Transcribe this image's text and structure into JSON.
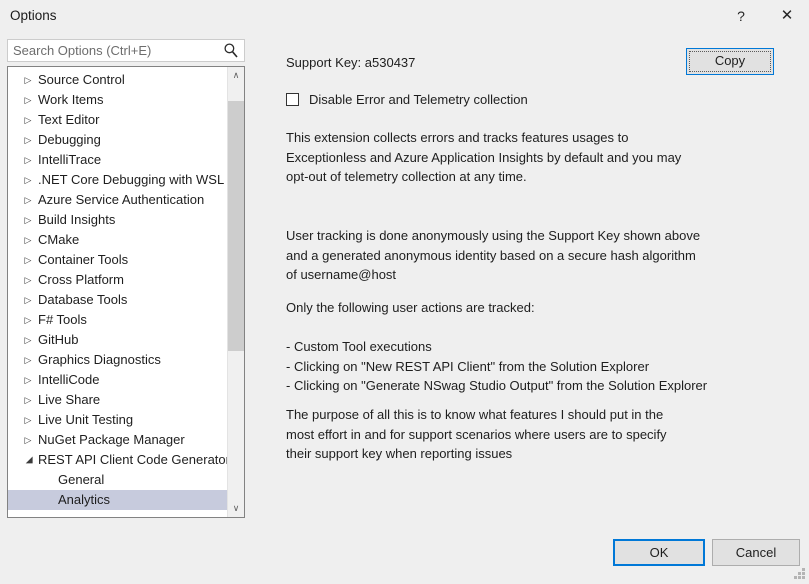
{
  "window": {
    "title": "Options",
    "help_glyph": "?",
    "close_glyph": "✕"
  },
  "search": {
    "placeholder": "Search Options (Ctrl+E)",
    "value": "",
    "icon": "search-icon"
  },
  "tree": {
    "items": [
      {
        "label": "Source Control",
        "expandable": true,
        "expanded": false,
        "selected": false,
        "child": false
      },
      {
        "label": "Work Items",
        "expandable": true,
        "expanded": false,
        "selected": false,
        "child": false
      },
      {
        "label": "Text Editor",
        "expandable": true,
        "expanded": false,
        "selected": false,
        "child": false
      },
      {
        "label": "Debugging",
        "expandable": true,
        "expanded": false,
        "selected": false,
        "child": false
      },
      {
        "label": "IntelliTrace",
        "expandable": true,
        "expanded": false,
        "selected": false,
        "child": false
      },
      {
        "label": ".NET Core Debugging with WSL",
        "expandable": true,
        "expanded": false,
        "selected": false,
        "child": false
      },
      {
        "label": "Azure Service Authentication",
        "expandable": true,
        "expanded": false,
        "selected": false,
        "child": false
      },
      {
        "label": "Build Insights",
        "expandable": true,
        "expanded": false,
        "selected": false,
        "child": false
      },
      {
        "label": "CMake",
        "expandable": true,
        "expanded": false,
        "selected": false,
        "child": false
      },
      {
        "label": "Container Tools",
        "expandable": true,
        "expanded": false,
        "selected": false,
        "child": false
      },
      {
        "label": "Cross Platform",
        "expandable": true,
        "expanded": false,
        "selected": false,
        "child": false
      },
      {
        "label": "Database Tools",
        "expandable": true,
        "expanded": false,
        "selected": false,
        "child": false
      },
      {
        "label": "F# Tools",
        "expandable": true,
        "expanded": false,
        "selected": false,
        "child": false
      },
      {
        "label": "GitHub",
        "expandable": true,
        "expanded": false,
        "selected": false,
        "child": false
      },
      {
        "label": "Graphics Diagnostics",
        "expandable": true,
        "expanded": false,
        "selected": false,
        "child": false
      },
      {
        "label": "IntelliCode",
        "expandable": true,
        "expanded": false,
        "selected": false,
        "child": false
      },
      {
        "label": "Live Share",
        "expandable": true,
        "expanded": false,
        "selected": false,
        "child": false
      },
      {
        "label": "Live Unit Testing",
        "expandable": true,
        "expanded": false,
        "selected": false,
        "child": false
      },
      {
        "label": "NuGet Package Manager",
        "expandable": true,
        "expanded": false,
        "selected": false,
        "child": false
      },
      {
        "label": "REST API Client Code Generator",
        "expandable": true,
        "expanded": true,
        "selected": false,
        "child": false
      },
      {
        "label": "General",
        "expandable": false,
        "expanded": false,
        "selected": false,
        "child": true
      },
      {
        "label": "Analytics",
        "expandable": false,
        "expanded": false,
        "selected": true,
        "child": true
      }
    ],
    "scrollbar": {
      "up_glyph": "∧",
      "down_glyph": "∨"
    }
  },
  "content": {
    "support_key": "Support Key: a530437",
    "copy_label": "Copy",
    "checkbox_label": "Disable Error and Telemetry collection",
    "checkbox_checked": false,
    "paragraph_1": "This extension collects errors and tracks features usages to\nExceptionless and Azure Application Insights by default and you may\nopt-out of telemetry collection at any time.",
    "paragraph_2": "User tracking is done anonymously using the Support Key shown above\nand a generated anonymous identity based on a secure hash algorithm\nof username@host",
    "paragraph_3": "Only the following user actions are tracked:",
    "paragraph_4": "- Custom Tool executions\n- Clicking on \"New REST API Client\" from the Solution Explorer\n- Clicking on \"Generate NSwag Studio Output\" from the Solution Explorer",
    "paragraph_5": "The purpose of all this is to know what features I should put in the\nmost effort in and for support scenarios where users are to specify\ntheir support key when reporting issues"
  },
  "footer": {
    "ok_label": "OK",
    "cancel_label": "Cancel"
  },
  "colors": {
    "dialog_background": "#efefef",
    "accent_blue": "#0078d7",
    "selection": "#c7cbdd",
    "button_face": "#e1e1e1",
    "tree_border": "#828282",
    "scroll_thumb": "#cdcdcd"
  }
}
